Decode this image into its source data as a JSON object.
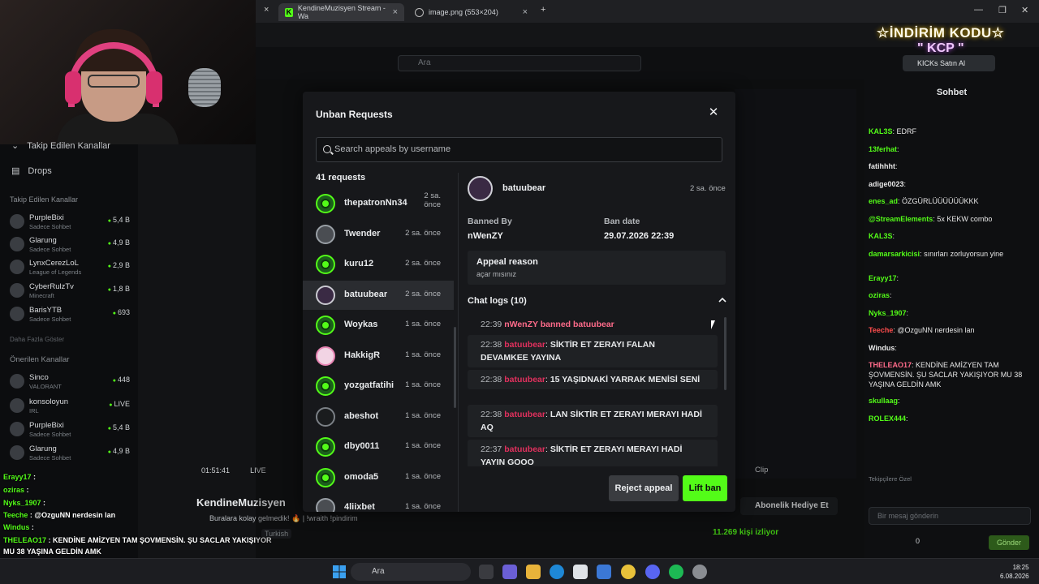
{
  "browser": {
    "tabs": [
      {
        "label": "KendineMuzisyen Stream - Wa",
        "active": true
      },
      {
        "label": "image.png (553×204)",
        "active": false
      }
    ]
  },
  "kick": {
    "search_placeholder": "Ara",
    "kicks_button": "KICKs Satın Al"
  },
  "promo": {
    "line1": "☆İNDİRİM KODU☆",
    "line2": "\" KCP \""
  },
  "sidebar": {
    "menu": [
      {
        "label": "Takip Edilen Kanallar"
      },
      {
        "label": "Drops"
      }
    ],
    "followed_header": "Takip Edilen Kanallar",
    "followed": [
      {
        "name": "PurpleBixi",
        "cat": "Sadece Sohbet",
        "viewers": "5,4 B"
      },
      {
        "name": "Glarung",
        "cat": "Sadece Sohbet",
        "viewers": "4,9 B"
      },
      {
        "name": "LynxCerezLoL",
        "cat": "League of Legends",
        "viewers": "2,9 B"
      },
      {
        "name": "CyberRulzTv",
        "cat": "Minecraft",
        "viewers": "1,8 B"
      },
      {
        "name": "BarisYTB",
        "cat": "Sadece Sohbet",
        "viewers": "693"
      }
    ],
    "show_more": "Daha Fazla Göster",
    "recommended_header": "Önerilen Kanallar",
    "recommended": [
      {
        "name": "Sinco",
        "cat": "VALORANT",
        "viewers": "448"
      },
      {
        "name": "konsoloyun",
        "cat": "IRL",
        "viewers": "LIVE"
      },
      {
        "name": "PurpleBixi",
        "cat": "Sadece Sohbet",
        "viewers": "5,4 B"
      },
      {
        "name": "Glarung",
        "cat": "Sadece Sohbet",
        "viewers": "4,9 B"
      }
    ]
  },
  "stream": {
    "streamer": "KendineMuzisyen",
    "title": "Buralara kolay gelmedik! 🔥 | !wraith !pindirim",
    "tag": "Turkish",
    "time": "01:51:41",
    "live": "LIVE",
    "viewers": "11.269 kişi izliyor",
    "sub_gift": "Abonelik Hediye Et",
    "clip": "Clip"
  },
  "chat": {
    "title": "Sohbet",
    "lines": [
      {
        "user": "KAL3S",
        "color": "#53fc18",
        "text": "EDRF"
      },
      {
        "user": "13ferhat",
        "color": "#53fc18",
        "text": ""
      },
      {
        "user": "fatihhht",
        "color": "#e6e6e6",
        "text": ""
      },
      {
        "user": "adige0023",
        "color": "#e6e6e6",
        "text": ""
      },
      {
        "user": "enes_ad",
        "color": "#53fc18",
        "text": "ÖZGÜRLÜÜÜÜÜÜKKK"
      },
      {
        "user": "@StreamElements",
        "color": "#53fc18",
        "text": "5x KEKW combo"
      },
      {
        "user": "KAL3S",
        "color": "#53fc18",
        "text": ""
      },
      {
        "user": "damarsarkicisi",
        "color": "#53fc18",
        "text": "sınırları zorluyorsun yine"
      },
      {
        "user": "Erayy17",
        "color": "#53fc18",
        "text": ""
      },
      {
        "user": "oziras",
        "color": "#53fc18",
        "text": ""
      },
      {
        "user": "Nyks_1907",
        "color": "#53fc18",
        "text": ""
      },
      {
        "user": "Teeche",
        "color": "#ff4d4d",
        "text": "@OzguNN nerdesin lan"
      },
      {
        "user": "Windus",
        "color": "#e6e6e6",
        "text": ""
      },
      {
        "user": "THELEAO17",
        "color": "#ff6b8a",
        "text": "KENDİNE AMİZYEN TAM ŞOVMENSİN. ŞU SACLAR YAKIŞIYOR MU 38 YAŞINA GELDİN AMK"
      },
      {
        "user": "skullaag",
        "color": "#53fc18",
        "text": ""
      },
      {
        "user": "ROLEX444",
        "color": "#53fc18",
        "text": ""
      }
    ],
    "input_placeholder": "Bir mesaj gönderin",
    "send": "Gönder",
    "kicks_count": "0",
    "tops": "Tekipçilere Özel"
  },
  "overlay_chat": [
    {
      "user": "Erayy17",
      "text": ""
    },
    {
      "user": "oziras",
      "text": ""
    },
    {
      "user": "Nyks_1907",
      "text": ""
    },
    {
      "user": "Teeche",
      "text": "@OzguNN nerdesin lan"
    },
    {
      "user": "Windus",
      "text": ""
    },
    {
      "user": "THELEAO17",
      "text": "KENDİNE AMİZYEN TAM ŞOVMENSİN. ŞU SACLAR YAKIŞIYOR"
    },
    {
      "user": "",
      "text": "MU 38 YAŞINA GELDİN AMK"
    },
    {
      "user": "skullaag",
      "text": ""
    },
    {
      "user": "ROLEX444",
      "text": ""
    }
  ],
  "modal": {
    "title": "Unban Requests",
    "search_placeholder": "Search appeals by username",
    "count": "41 requests",
    "requests": [
      {
        "name": "thepatronNn34",
        "time": "2 sa. önce",
        "avatar": "green"
      },
      {
        "name": "Twender",
        "time": "2 sa. önce",
        "avatar": "gray"
      },
      {
        "name": "kuru12",
        "time": "2 sa. önce",
        "avatar": "green"
      },
      {
        "name": "batuubear",
        "time": "2 sa. önce",
        "avatar": "purple"
      },
      {
        "name": "Woykas",
        "time": "1 sa. önce",
        "avatar": "green"
      },
      {
        "name": "HakkigR",
        "time": "1 sa. önce",
        "avatar": "pink"
      },
      {
        "name": "yozgatfatihi",
        "time": "1 sa. önce",
        "avatar": "green"
      },
      {
        "name": "abeshot",
        "time": "1 sa. önce",
        "avatar": "dark"
      },
      {
        "name": "dby0011",
        "time": "1 sa. önce",
        "avatar": "green"
      },
      {
        "name": "omoda5",
        "time": "1 sa. önce",
        "avatar": "green"
      },
      {
        "name": "4liixbet",
        "time": "1 sa. önce",
        "avatar": "gray"
      }
    ],
    "selected_index": 3,
    "detail": {
      "username": "batuubear",
      "time": "2 sa. önce",
      "banned_by_label": "Banned By",
      "banned_by": "nWenZY",
      "ban_date_label": "Ban date",
      "ban_date": "29.07.2026 22:39",
      "appeal_reason_label": "Appeal reason",
      "appeal_reason": "açar mısınız",
      "chat_logs_label": "Chat logs (10)",
      "logs": [
        {
          "time": "22:39",
          "user": "",
          "text": "nWenZY banned batuubear",
          "type": "ban"
        },
        {
          "time": "22:38",
          "user": "batuubear",
          "text": "SİKTİR ET ZERAYI FALAN DEVAMKEE YAYINA",
          "type": "msg"
        },
        {
          "time": "22:38",
          "user": "batuubear",
          "text": "15 YAŞIDNAKİ YARRAK MENİSİ SENİ",
          "type": "msg"
        },
        {
          "time": "22:38",
          "user": "batuubear",
          "text": "LAN SİKTİR ET ZERAYI MERAYI HADİ AQ",
          "type": "msg"
        },
        {
          "time": "22:37",
          "user": "batuubear",
          "text": "SİKTİR ET ZERAYI MERAYI HADİ YAYIN GOOO",
          "type": "msg"
        }
      ]
    },
    "reject_label": "Reject appeal",
    "lift_label": "Lift ban"
  },
  "taskbar": {
    "search": "Ara",
    "time": "18:25",
    "date": "6.08.2026"
  },
  "colors": {
    "kick_green": "#53fc18",
    "ban_red": "#e0305d"
  }
}
